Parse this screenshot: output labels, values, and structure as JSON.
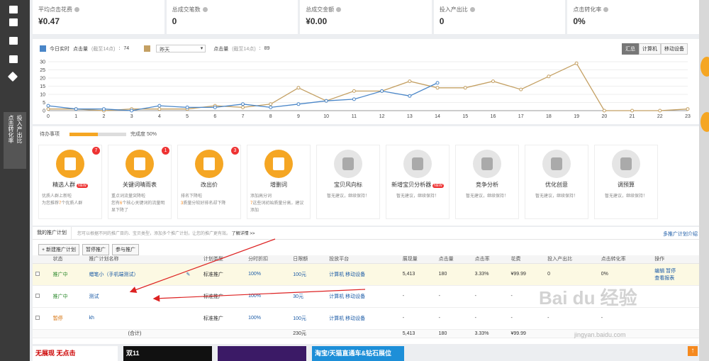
{
  "stats": [
    {
      "label": "平均点击花费",
      "value": "¥0.47"
    },
    {
      "label": "总成交笔数",
      "value": "0"
    },
    {
      "label": "总成交金额",
      "value": "¥0.00"
    },
    {
      "label": "投入产出比",
      "value": "0"
    },
    {
      "label": "点击转化率",
      "value": "0%"
    }
  ],
  "sidebar": {
    "vertical_tab": [
      "点击转化率",
      "投入产出比"
    ],
    "arrow": "↑"
  },
  "chart_legend": {
    "today": "今日实时",
    "today_metric": "点击量",
    "today_note": "(截至14点)",
    "today_value": "74",
    "compare_select": "昨天",
    "compare_metric": "点击量",
    "compare_note": "(截至14点)",
    "compare_value": "89"
  },
  "view_buttons": [
    "汇总",
    "计算机",
    "移动设备"
  ],
  "chart_data": {
    "type": "line",
    "x": [
      0,
      1,
      2,
      3,
      4,
      5,
      6,
      7,
      8,
      9,
      10,
      11,
      12,
      13,
      14,
      15,
      16,
      17,
      18,
      19,
      20,
      21,
      22,
      23
    ],
    "ylim": [
      0,
      30
    ],
    "yticks": [
      0,
      5,
      10,
      15,
      20,
      25,
      30
    ],
    "colors": {
      "today": "#4a86c8",
      "yesterday": "#c4a063"
    },
    "series": [
      {
        "values": [
          3,
          1,
          1,
          0,
          3,
          2,
          2,
          4,
          2,
          4,
          6,
          7,
          12,
          9,
          17
        ]
      },
      {
        "values": [
          1,
          1,
          0,
          1,
          1,
          1,
          3,
          2,
          4,
          14,
          6,
          12,
          12,
          18,
          14,
          14,
          18,
          13,
          21,
          29,
          0,
          0,
          0,
          1
        ]
      }
    ]
  },
  "todo": {
    "label": "待办事项",
    "progress_label": "完成度 50%",
    "progress": 0.5
  },
  "tiles": [
    {
      "name": "精选人群",
      "badge": "7",
      "tag": "NEW",
      "active": true,
      "desc_parts": [
        "优质人群上新啦",
        "为您推荐",
        "7",
        "个优质人群"
      ]
    },
    {
      "name": "关键词晴雨表",
      "badge": "1",
      "active": true,
      "desc_parts": [
        "重点词流量突降啦",
        "您有",
        "6",
        "个核心关键词的流量明显下降了"
      ]
    },
    {
      "name": "改出价",
      "badge": "3",
      "active": true,
      "desc_parts": [
        "排名下降啦",
        "3",
        "质量分较好排名却下降"
      ]
    },
    {
      "name": "增删词",
      "active": true,
      "desc_parts": [
        "添加高分词",
        "7",
        "这些词初始质量分高，建议添加"
      ]
    },
    {
      "name": "宝贝风向标",
      "active": false,
      "desc": "暂无建议，继续保持！"
    },
    {
      "name": "新增宝贝分析器",
      "tag": "NEW",
      "active": false,
      "desc": "暂无建议，继续保持！"
    },
    {
      "name": "竞争分析",
      "active": false,
      "desc": "暂无建议，继续保持！"
    },
    {
      "name": "优化创意",
      "active": false,
      "desc": "暂无建议，继续保持！"
    },
    {
      "name": "调预算",
      "active": false,
      "desc": "暂无建议，继续保持！"
    }
  ],
  "plan": {
    "tab": "我的推广计划",
    "hint": "您可以根据不同的推广目的、宝贝类型，添加多个推广计划，让您的推广更有效。",
    "hint_link": "了解详情 >>",
    "right_link": "多推广计划介绍",
    "buttons": [
      "+ 新建推广计划",
      "暂停推广",
      "参与推广"
    ],
    "columns": [
      "",
      "状态",
      "推广计划名称",
      "",
      "计划类型",
      "分时折扣",
      "日限额",
      "投放平台",
      "展现量",
      "点击量",
      "点击率",
      "花费",
      "投入产出比",
      "点击转化率",
      "操作"
    ],
    "rows": [
      {
        "status": "推广中",
        "status_class": "g",
        "name": "蜡笔小（手机端测试）",
        "type": "标准推广",
        "discount": "100%",
        "limit": "100元",
        "platform": "计算机 移动设备",
        "impr": "5,413",
        "clicks": "180",
        "ctr": "3.33%",
        "cost": "¥99.99",
        "roi": "0",
        "cvr": "0%",
        "ops": [
          "编辑",
          "暂停",
          "查看报表"
        ]
      },
      {
        "status": "推广中",
        "status_class": "g",
        "name": "测试",
        "type": "标准推广",
        "discount": "100%",
        "limit": "30元",
        "platform": "计算机 移动设备",
        "impr": "-",
        "clicks": "-",
        "ctr": "-",
        "cost": "-",
        "roi": "-",
        "cvr": "-",
        "ops": []
      },
      {
        "status": "暂停",
        "status_class": "o",
        "name": "kh",
        "type": "标准推广",
        "discount": "100%",
        "limit": "100元",
        "platform": "计算机 移动设备",
        "impr": "-",
        "clicks": "-",
        "ctr": "-",
        "cost": "-",
        "roi": "-",
        "cvr": "-",
        "ops": []
      }
    ],
    "total": {
      "label": "(合计)",
      "limit": "230元",
      "impr": "5,413",
      "clicks": "180",
      "ctr": "3.33%",
      "cost": "¥99.99"
    }
  },
  "ads": [
    {
      "text": "无展现 无点击",
      "bg": "#fff",
      "color": "#c00"
    },
    {
      "text": "双11",
      "bg": "#111",
      "color": "#fff"
    },
    {
      "text": "",
      "bg": "#3b1a66",
      "color": "#fff"
    },
    {
      "text": "淘宝/天猫直通车&钻石展位",
      "bg": "#1d8fd8",
      "color": "#fff"
    }
  ],
  "watermark": "Bai du 经验",
  "watermark_url": "jingyan.baidu.com"
}
